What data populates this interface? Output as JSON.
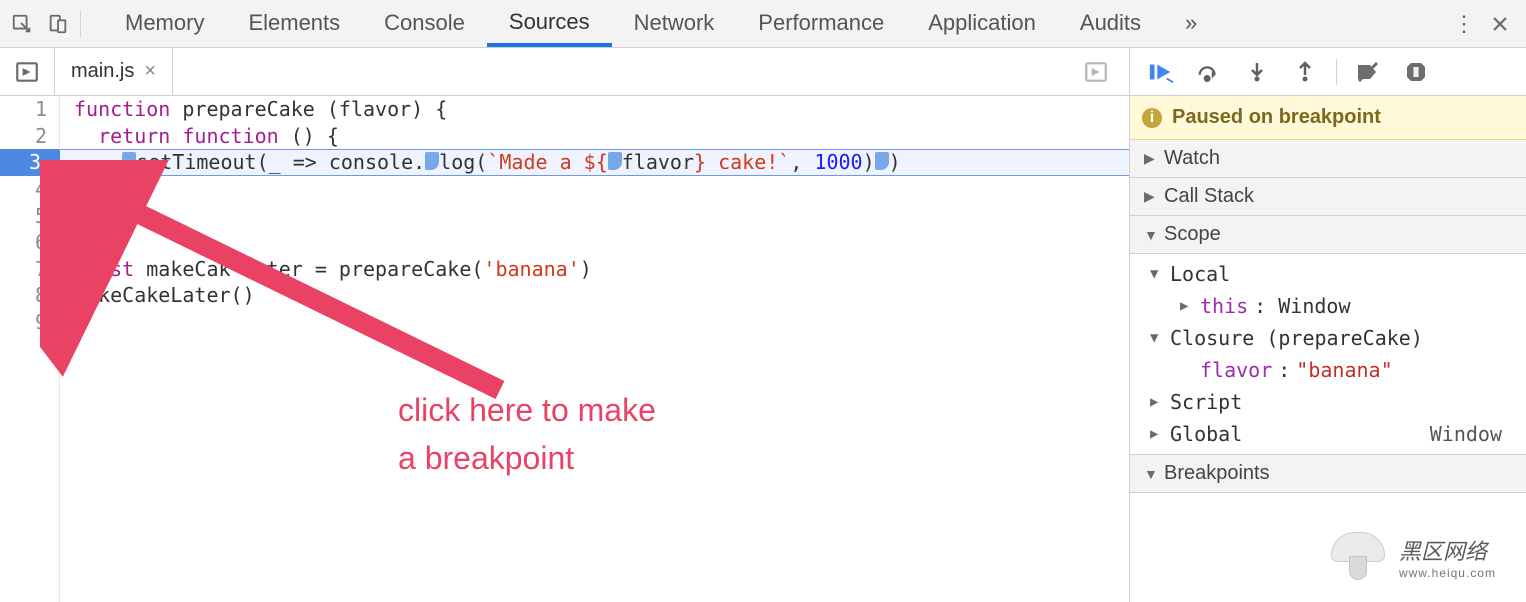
{
  "toolbar": {
    "tabs": [
      "Memory",
      "Elements",
      "Console",
      "Sources",
      "Network",
      "Performance",
      "Application",
      "Audits"
    ],
    "active_tab": "Sources",
    "more_icon": "»"
  },
  "file_tab": {
    "name": "main.js",
    "close_glyph": "×"
  },
  "gutter_lines": [
    "1",
    "2",
    "3",
    "4",
    "5",
    "6",
    "7",
    "8",
    "9"
  ],
  "breakpoint_line_index": 2,
  "code": {
    "l1_a": "function",
    "l1_b": " prepareCake (flavor) {",
    "l2_a": "  ",
    "l2_b": "return",
    "l2_c": " ",
    "l2_d": "function",
    "l2_e": " () {",
    "l3_a": "    ",
    "l3_b": "setTimeout(_ => console.",
    "l3_c": "log",
    "l3_d": "(",
    "l3_e": "`Made a ${",
    "l3_f": "flavor",
    "l3_g": "} cake!`",
    "l3_h": ", ",
    "l3_i": "1000",
    "l3_j": ")",
    "l3_k": ")",
    "l4": "  }",
    "l5": "}",
    "l6": "",
    "l7_a": "const",
    "l7_b": " makeCak",
    "l7_c": "ter = prepareCake(",
    "l7_d": "'banana'",
    "l7_e": ")",
    "l8": "makeCakeLater()",
    "l9": ""
  },
  "debugger": {
    "banner": "Paused on breakpoint",
    "sections": {
      "watch": "Watch",
      "callstack": "Call Stack",
      "scope": "Scope",
      "breakpoints": "Breakpoints"
    },
    "scope": {
      "local": "Local",
      "this_label": "this",
      "this_value": ": Window",
      "closure": "Closure (prepareCake)",
      "flavor_label": "flavor",
      "flavor_value": ": ",
      "flavor_string": "\"banana\"",
      "script": "Script",
      "global": "Global",
      "global_value": "Window"
    }
  },
  "annotation": {
    "line1": "click here to make",
    "line2": "a breakpoint"
  },
  "watermark": {
    "text": "黑区网络",
    "url": "www.heiqu.com"
  }
}
